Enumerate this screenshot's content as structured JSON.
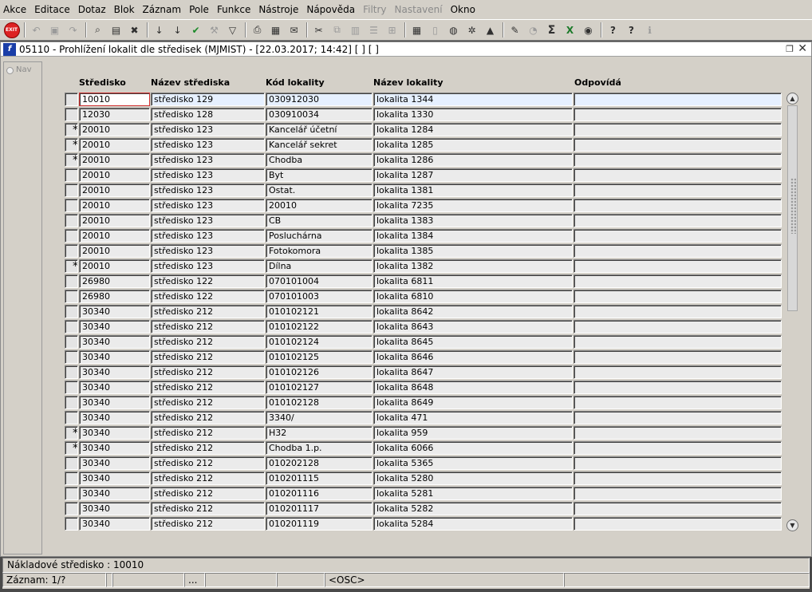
{
  "menu": [
    "Akce",
    "Editace",
    "Dotaz",
    "Blok",
    "Záznam",
    "Pole",
    "Funkce",
    "Nástroje",
    "Nápověda",
    "Filtry",
    "Nastavení",
    "Okno"
  ],
  "menu_disabled": [
    "Filtry",
    "Nastavení"
  ],
  "toolbar": {
    "exit_label": "EXIT",
    "icons": [
      "exit-icon",
      "undo-icon",
      "save-icon",
      "redo-icon",
      "enter-query-icon",
      "execute-query-icon",
      "cancel-query-icon",
      "sort-asc-icon",
      "sort-desc-icon",
      "checkmark-icon",
      "wrench-icon",
      "filter-icon",
      "print-icon",
      "print-preview-icon",
      "mail-icon",
      "cut-icon",
      "copy-icon",
      "paste-icon",
      "list-icon",
      "tree-icon",
      "calendar-icon",
      "document-icon",
      "globe-icon",
      "gear-icon",
      "chart-icon",
      "edit-icon",
      "clock-icon",
      "sigma-icon",
      "excel-icon",
      "refresh-icon",
      "help-icon",
      "whats-this-icon",
      "info-icon"
    ]
  },
  "window": {
    "title": "05110 - Prohlížení lokalit dle středisek (MJMIST) - [22.03.2017; 14:42]  [ ]  [ ]",
    "nav_label": "Nav"
  },
  "columns": {
    "stredisko": "Středisko",
    "nazev_strediska": "Název střediska",
    "kod_lokality": "Kód lokality",
    "nazev_lokality": "Název lokality",
    "odpovida": "Odpovídá"
  },
  "rows": [
    {
      "mark": "",
      "stredisko": "10010",
      "nazev_strediska": "středisko 129",
      "kod_lokality": "030912030",
      "nazev_lokality": "lokalita 1344",
      "odpovida": ""
    },
    {
      "mark": "",
      "stredisko": "12030",
      "nazev_strediska": "středisko 128",
      "kod_lokality": "030910034",
      "nazev_lokality": "lokalita 1330",
      "odpovida": ""
    },
    {
      "mark": "*",
      "stredisko": "20010",
      "nazev_strediska": "středisko 123",
      "kod_lokality": "Kancelář účetní",
      "nazev_lokality": "lokalita 1284",
      "odpovida": ""
    },
    {
      "mark": "*",
      "stredisko": "20010",
      "nazev_strediska": "středisko 123",
      "kod_lokality": "Kancelář sekret",
      "nazev_lokality": "lokalita 1285",
      "odpovida": ""
    },
    {
      "mark": "*",
      "stredisko": "20010",
      "nazev_strediska": "středisko 123",
      "kod_lokality": "Chodba",
      "nazev_lokality": "lokalita 1286",
      "odpovida": ""
    },
    {
      "mark": "",
      "stredisko": "20010",
      "nazev_strediska": "středisko 123",
      "kod_lokality": "Byt",
      "nazev_lokality": "lokalita 1287",
      "odpovida": ""
    },
    {
      "mark": "",
      "stredisko": "20010",
      "nazev_strediska": "středisko 123",
      "kod_lokality": "Ostat.",
      "nazev_lokality": "lokalita 1381",
      "odpovida": ""
    },
    {
      "mark": "",
      "stredisko": "20010",
      "nazev_strediska": "středisko 123",
      "kod_lokality": "20010",
      "nazev_lokality": "lokalita 7235",
      "odpovida": ""
    },
    {
      "mark": "",
      "stredisko": "20010",
      "nazev_strediska": "středisko 123",
      "kod_lokality": "CB",
      "nazev_lokality": "lokalita 1383",
      "odpovida": ""
    },
    {
      "mark": "",
      "stredisko": "20010",
      "nazev_strediska": "středisko 123",
      "kod_lokality": "Posluchárna",
      "nazev_lokality": "lokalita 1384",
      "odpovida": ""
    },
    {
      "mark": "",
      "stredisko": "20010",
      "nazev_strediska": "středisko 123",
      "kod_lokality": "Fotokomora",
      "nazev_lokality": "lokalita 1385",
      "odpovida": ""
    },
    {
      "mark": "*",
      "stredisko": "20010",
      "nazev_strediska": "středisko 123",
      "kod_lokality": "Dílna",
      "nazev_lokality": "lokalita 1382",
      "odpovida": ""
    },
    {
      "mark": "",
      "stredisko": "26980",
      "nazev_strediska": "středisko 122",
      "kod_lokality": "070101004",
      "nazev_lokality": "lokalita 6811",
      "odpovida": ""
    },
    {
      "mark": "",
      "stredisko": "26980",
      "nazev_strediska": "středisko 122",
      "kod_lokality": "070101003",
      "nazev_lokality": "lokalita 6810",
      "odpovida": ""
    },
    {
      "mark": "",
      "stredisko": "30340",
      "nazev_strediska": "středisko 212",
      "kod_lokality": "010102121",
      "nazev_lokality": "lokalita 8642",
      "odpovida": ""
    },
    {
      "mark": "",
      "stredisko": "30340",
      "nazev_strediska": "středisko 212",
      "kod_lokality": "010102122",
      "nazev_lokality": "lokalita 8643",
      "odpovida": ""
    },
    {
      "mark": "",
      "stredisko": "30340",
      "nazev_strediska": "středisko 212",
      "kod_lokality": "010102124",
      "nazev_lokality": "lokalita 8645",
      "odpovida": ""
    },
    {
      "mark": "",
      "stredisko": "30340",
      "nazev_strediska": "středisko 212",
      "kod_lokality": "010102125",
      "nazev_lokality": "lokalita 8646",
      "odpovida": ""
    },
    {
      "mark": "",
      "stredisko": "30340",
      "nazev_strediska": "středisko 212",
      "kod_lokality": "010102126",
      "nazev_lokality": "lokalita 8647",
      "odpovida": ""
    },
    {
      "mark": "",
      "stredisko": "30340",
      "nazev_strediska": "středisko 212",
      "kod_lokality": "010102127",
      "nazev_lokality": "lokalita 8648",
      "odpovida": ""
    },
    {
      "mark": "",
      "stredisko": "30340",
      "nazev_strediska": "středisko 212",
      "kod_lokality": "010102128",
      "nazev_lokality": "lokalita 8649",
      "odpovida": ""
    },
    {
      "mark": "",
      "stredisko": "30340",
      "nazev_strediska": "středisko 212",
      "kod_lokality": "3340/",
      "nazev_lokality": "lokalita 471",
      "odpovida": ""
    },
    {
      "mark": "*",
      "stredisko": "30340",
      "nazev_strediska": "středisko 212",
      "kod_lokality": "H32",
      "nazev_lokality": "lokalita 959",
      "odpovida": ""
    },
    {
      "mark": "*",
      "stredisko": "30340",
      "nazev_strediska": "středisko 212",
      "kod_lokality": "Chodba 1.p.",
      "nazev_lokality": "lokalita 6066",
      "odpovida": ""
    },
    {
      "mark": "",
      "stredisko": "30340",
      "nazev_strediska": "středisko 212",
      "kod_lokality": "010202128",
      "nazev_lokality": "lokalita 5365",
      "odpovida": ""
    },
    {
      "mark": "",
      "stredisko": "30340",
      "nazev_strediska": "středisko 212",
      "kod_lokality": "010201115",
      "nazev_lokality": "lokalita 5280",
      "odpovida": ""
    },
    {
      "mark": "",
      "stredisko": "30340",
      "nazev_strediska": "středisko 212",
      "kod_lokality": "010201116",
      "nazev_lokality": "lokalita 5281",
      "odpovida": ""
    },
    {
      "mark": "",
      "stredisko": "30340",
      "nazev_strediska": "středisko 212",
      "kod_lokality": "010201117",
      "nazev_lokality": "lokalita 5282",
      "odpovida": ""
    },
    {
      "mark": "",
      "stredisko": "30340",
      "nazev_strediska": "středisko 212",
      "kod_lokality": "010201119",
      "nazev_lokality": "lokalita 5284",
      "odpovida": ""
    }
  ],
  "hint": "Nákladové středisko : 10010",
  "status": [
    "Záznam: 1/?",
    "",
    "",
    "...",
    "",
    "",
    "<OSC>",
    ""
  ],
  "colors": {
    "selected_row": "#e6f0ff",
    "current_cell_border": "#d03030",
    "titlebar_icon": "#1a3ea8"
  }
}
